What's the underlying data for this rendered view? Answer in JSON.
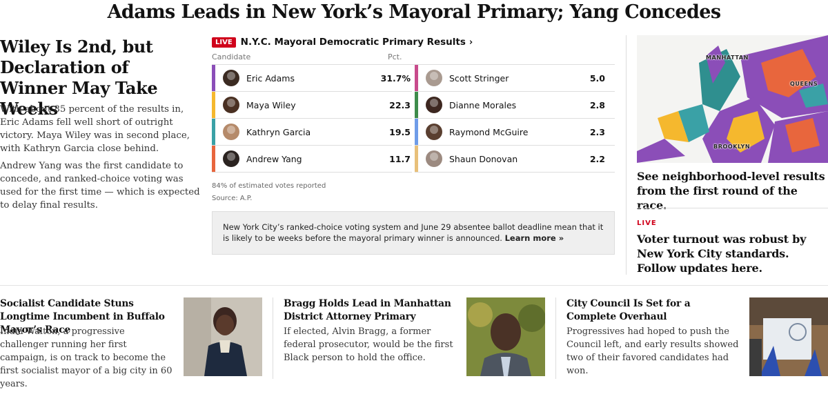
{
  "headline": "Adams Leads in New York’s Mayoral Primary; Yang Concedes",
  "lead": {
    "title": "Wiley Is 2nd, but Declaration of Winner May Take Weeks",
    "p1": "With about 85 percent of the results in, Eric Adams fell well short of outright victory. Maya Wiley was in second place, with Kathryn Garcia close behind.",
    "p2": "Andrew Yang was the first candidate to concede, and ranked-choice voting was used for the first time — which is expected to delay final results."
  },
  "results": {
    "live_badge": "LIVE",
    "title": "N.Y.C. Mayoral Democratic Primary Results",
    "chevron": "›",
    "col_candidate": "Candidate",
    "col_pct": "Pct.",
    "left": [
      {
        "name": "Eric Adams",
        "pct": "31.7%",
        "color": "#8b4eb8",
        "avatar": "#3b2b22"
      },
      {
        "name": "Maya Wiley",
        "pct": "22.3",
        "color": "#f5b82e",
        "avatar": "#4a3022"
      },
      {
        "name": "Kathryn Garcia",
        "pct": "19.5",
        "color": "#3aa1a6",
        "avatar": "#b58a6a"
      },
      {
        "name": "Andrew Yang",
        "pct": "11.7",
        "color": "#e8663d",
        "avatar": "#2b2320"
      }
    ],
    "right": [
      {
        "name": "Scott Stringer",
        "pct": "5.0",
        "color": "#c84b8c",
        "avatar": "#a99a90"
      },
      {
        "name": "Dianne Morales",
        "pct": "2.8",
        "color": "#3e8c4b",
        "avatar": "#3d2720"
      },
      {
        "name": "Raymond McGuire",
        "pct": "2.3",
        "color": "#6f9ce8",
        "avatar": "#5a3f30"
      },
      {
        "name": "Shaun Donovan",
        "pct": "2.2",
        "color": "#e8c07a",
        "avatar": "#9c8a80"
      }
    ],
    "reported": "84% of estimated votes reported",
    "source": "Source: A.P.",
    "note": "New York City’s ranked-choice voting system and June 29 absentee ballot deadline mean that it is likely to be weeks before the mayoral primary winner is announced.",
    "learn_more": "Learn more »"
  },
  "map": {
    "manhattan": "MANHATTAN",
    "queens": "QUEENS",
    "brooklyn": "BROOKLYN"
  },
  "right": {
    "map_headline": "See neighborhood-level results from the first round of the race.",
    "live_label": "LIVE",
    "turnout_headline": "Voter turnout was robust by New York City standards. Follow updates here."
  },
  "stories": [
    {
      "title": "Socialist Candidate Stuns Longtime Incumbent in Buffalo Mayor’s Race",
      "summary": "India Walton, a progressive challenger running her first campaign, is on track to become the first socialist mayor of a big city in 60 years."
    },
    {
      "title": "Bragg Holds Lead in Manhattan District Attorney Primary",
      "summary": "If elected, Alvin Bragg, a former federal prosecutor, would be the first Black person to hold the office."
    },
    {
      "title": "City Council Is Set for a Complete Overhaul",
      "summary": "Progressives had hoped to push the Council left, and early results showed two of their favored candidates had won."
    }
  ]
}
